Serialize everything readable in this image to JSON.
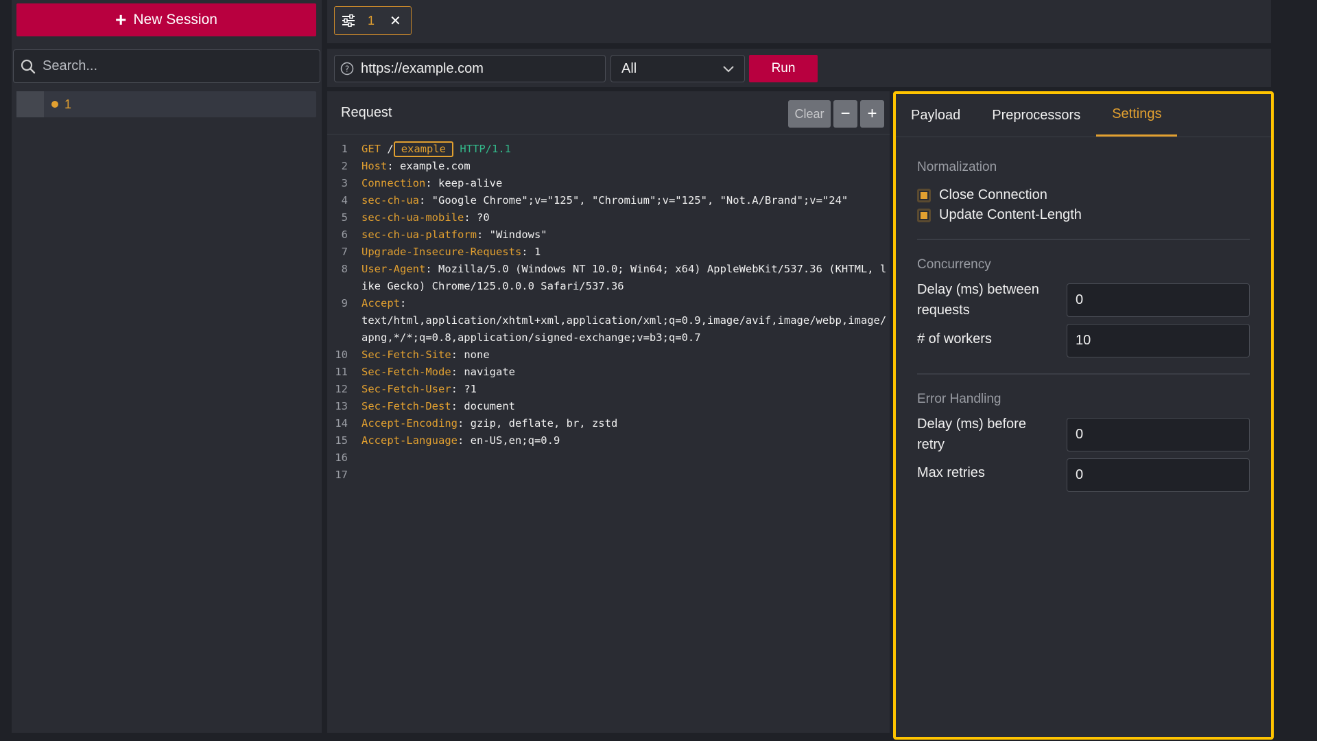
{
  "sidebar": {
    "new_session_label": "New Session",
    "search_placeholder": "Search...",
    "sessions": [
      {
        "label": "1"
      }
    ]
  },
  "topbar": {
    "tab": {
      "label": "1"
    }
  },
  "urlbar": {
    "url": "https://example.com",
    "method_select": "All",
    "run_label": "Run"
  },
  "request": {
    "title": "Request",
    "clear_label": "Clear",
    "minus_label": "−",
    "plus_label": "+",
    "line_numbers": [
      "1",
      "2",
      "3",
      "4",
      "5",
      "6",
      "7",
      "8",
      "9",
      "10",
      "11",
      "12",
      "13",
      "14",
      "15",
      "16",
      "17"
    ],
    "request_line": {
      "method": "GET",
      "slash": "/",
      "marker": "example",
      "version": "HTTP/1.1"
    },
    "headers": [
      {
        "key": "Host",
        "value": "example.com"
      },
      {
        "key": "Connection",
        "value": "keep-alive"
      },
      {
        "key": "sec-ch-ua",
        "value": "\"Google Chrome\";v=\"125\", \"Chromium\";v=\"125\", \"Not.A/Brand\";v=\"24\""
      },
      {
        "key": "sec-ch-ua-mobile",
        "value": "?0"
      },
      {
        "key": "sec-ch-ua-platform",
        "value": "\"Windows\""
      },
      {
        "key": "Upgrade-Insecure-Requests",
        "value": "1"
      },
      {
        "key": "User-Agent",
        "value": "Mozilla/5.0 (Windows NT 10.0; Win64; x64) AppleWebKit/537.36 (KHTML, like Gecko) Chrome/125.0.0.0 Safari/537.36"
      },
      {
        "key": "Accept",
        "value": "text/html,application/xhtml+xml,application/xml;q=0.9,image/avif,image/webp,image/apng,*/*;q=0.8,application/signed-exchange;v=b3;q=0.7"
      },
      {
        "key": "Sec-Fetch-Site",
        "value": "none"
      },
      {
        "key": "Sec-Fetch-Mode",
        "value": "navigate"
      },
      {
        "key": "Sec-Fetch-User",
        "value": "?1"
      },
      {
        "key": "Sec-Fetch-Dest",
        "value": "document"
      },
      {
        "key": "Accept-Encoding",
        "value": "gzip, deflate, br, zstd"
      },
      {
        "key": "Accept-Language",
        "value": "en-US,en;q=0.9"
      }
    ]
  },
  "settings": {
    "tabs": [
      {
        "label": "Payload",
        "active": false
      },
      {
        "label": "Preprocessors",
        "active": false
      },
      {
        "label": "Settings",
        "active": true
      }
    ],
    "normalization": {
      "title": "Normalization",
      "close_connection": "Close Connection",
      "update_content_length": "Update Content-Length"
    },
    "concurrency": {
      "title": "Concurrency",
      "delay_label": "Delay (ms) between requests",
      "delay_value": "0",
      "workers_label": "# of workers",
      "workers_value": "10"
    },
    "error_handling": {
      "title": "Error Handling",
      "retry_delay_label": "Delay (ms) before retry",
      "retry_delay_value": "0",
      "max_retries_label": "Max retries",
      "max_retries_value": "0"
    }
  },
  "colors": {
    "accent": "#e2a030",
    "brand": "#b8003f",
    "highlight": "#ffc400"
  }
}
